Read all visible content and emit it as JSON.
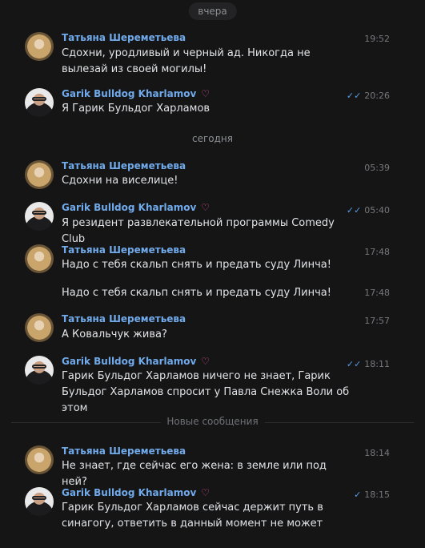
{
  "dates": {
    "yesterday": "вчера",
    "today": "сегодня"
  },
  "new_messages_label": "Новые сообщения",
  "messages": [
    {
      "author": "Татьяна Шереметьева",
      "time": "19:52",
      "text": "Сдохни, уродливый и черный ад. Никогда не вылезай из своей могилы!"
    },
    {
      "author": "Garik Bulldog Kharlamov",
      "time": "20:26",
      "status": "✓✓",
      "text": "Я Гарик Бульдог Харламов"
    },
    {
      "author": "Татьяна Шереметьева",
      "time": "05:39",
      "text": "Сдохни на виселице!"
    },
    {
      "author": "Garik Bulldog Kharlamov",
      "time": "05:40",
      "status": "✓✓",
      "text": "Я резидент развлекательной программы Comedy Club"
    },
    {
      "author": "Татьяна Шереметьева",
      "time": "17:48",
      "text": "Надо с тебя скальп снять и предать суду Линча!"
    },
    {
      "time": "17:48",
      "text": "Надо с тебя скальп снять и предать суду Линча!"
    },
    {
      "author": "Татьяна Шереметьева",
      "time": "17:57",
      "text": "А Ковальчук жива?"
    },
    {
      "author": "Garik Bulldog Kharlamov",
      "time": "18:11",
      "status": "✓✓",
      "text": "Гарик Бульдог Харламов ничего не знает, Гарик Бульдог Харламов спросит у Павла Снежка Воли об этом"
    },
    {
      "author": "Татьяна Шереметьева",
      "time": "18:14",
      "text": "Не знает, где сейчас его жена: в земле или под ней?"
    },
    {
      "author": "Garik Bulldog Kharlamov",
      "time": "18:15",
      "status": "✓",
      "text": "Гарик Бульдог Харламов сейчас держит путь в синагогу, ответить в данный момент не может"
    }
  ],
  "icons": {
    "verified": "heart-badge-icon",
    "read": "double-check-icon",
    "sent": "check-icon"
  },
  "colors": {
    "background": "#151516",
    "name": "#71aaeb",
    "text": "#e1e3e6",
    "muted": "#76787d",
    "badge": "#e0569e"
  }
}
